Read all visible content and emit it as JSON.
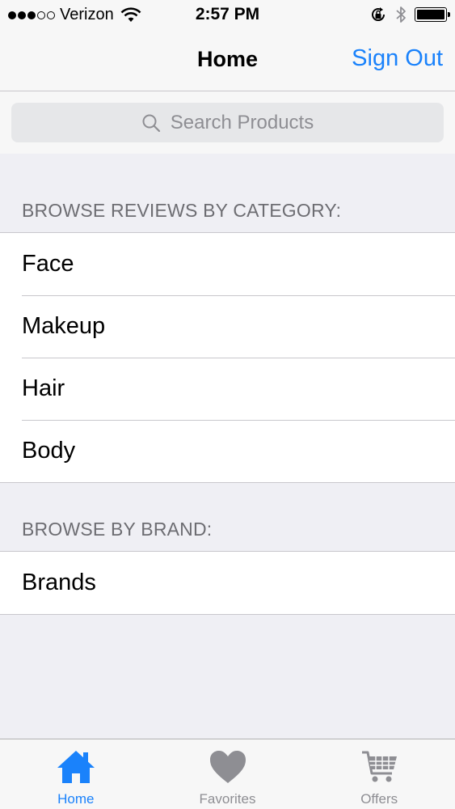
{
  "status_bar": {
    "carrier": "Verizon",
    "time": "2:57 PM",
    "signal_bars_filled": 3,
    "signal_bars_total": 5
  },
  "nav": {
    "title": "Home",
    "sign_out": "Sign Out"
  },
  "search": {
    "placeholder": "Search Products"
  },
  "sections": {
    "category": {
      "header": "BROWSE REVIEWS BY CATEGORY:",
      "items": [
        "Face",
        "Makeup",
        "Hair",
        "Body"
      ]
    },
    "brand": {
      "header": "BROWSE BY BRAND:",
      "items": [
        "Brands"
      ]
    }
  },
  "tabs": [
    {
      "label": "Home",
      "icon": "home-icon",
      "active": true
    },
    {
      "label": "Favorites",
      "icon": "heart-icon",
      "active": false
    },
    {
      "label": "Offers",
      "icon": "cart-icon",
      "active": false
    }
  ],
  "colors": {
    "accent": "#1a82fb",
    "inactive": "#8e8e93",
    "background": "#efeff4"
  }
}
